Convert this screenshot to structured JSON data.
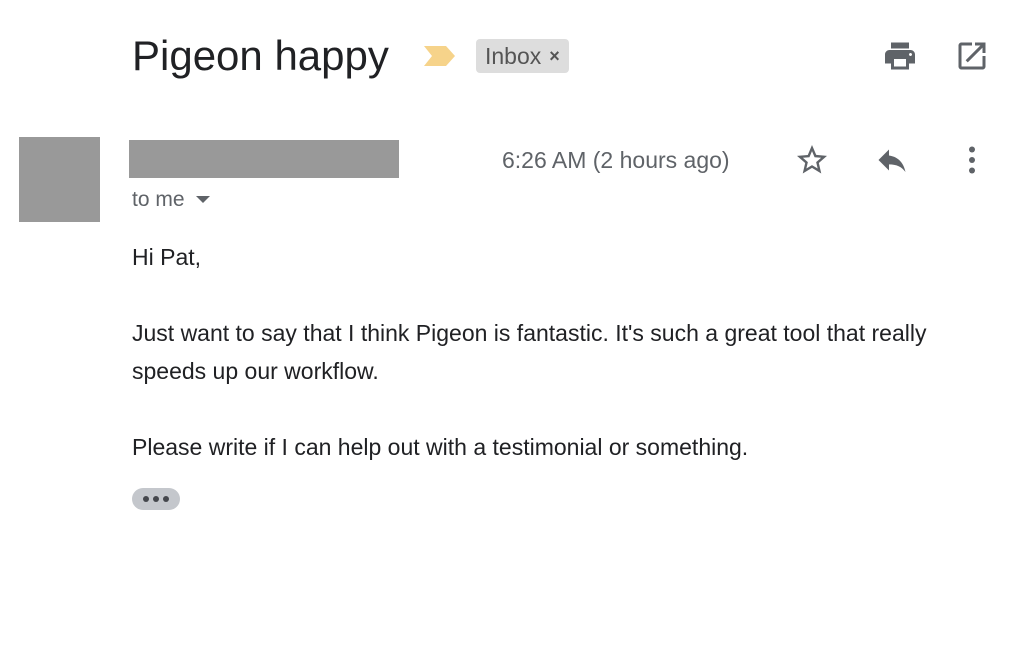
{
  "thread": {
    "subject": "Pigeon happy",
    "label": "Inbox",
    "label_remove_glyph": "×"
  },
  "toolbar": {
    "print_icon": "print-icon",
    "open_in_new_window_icon": "open-in-new-icon"
  },
  "message": {
    "sender_redacted": true,
    "timestamp": "6:26 AM (2 hours ago)",
    "recipients": "to me",
    "star_icon": "star-outline-icon",
    "reply_icon": "reply-icon",
    "more_icon": "more-vert-icon",
    "body": {
      "greeting": "Hi Pat,",
      "paragraph_1": "Just want to say that I think Pigeon is fantastic. It's such a great tool that really speeds up our workflow.",
      "paragraph_2": "Please write if I can help out with a testimonial or something."
    },
    "show_trimmed_icon": "ellipsis-icon"
  },
  "colors": {
    "importance_marker": "#F6D38A",
    "redaction": "#999999",
    "icon_gray": "#5f6368",
    "chip_bg": "#dddddd"
  }
}
